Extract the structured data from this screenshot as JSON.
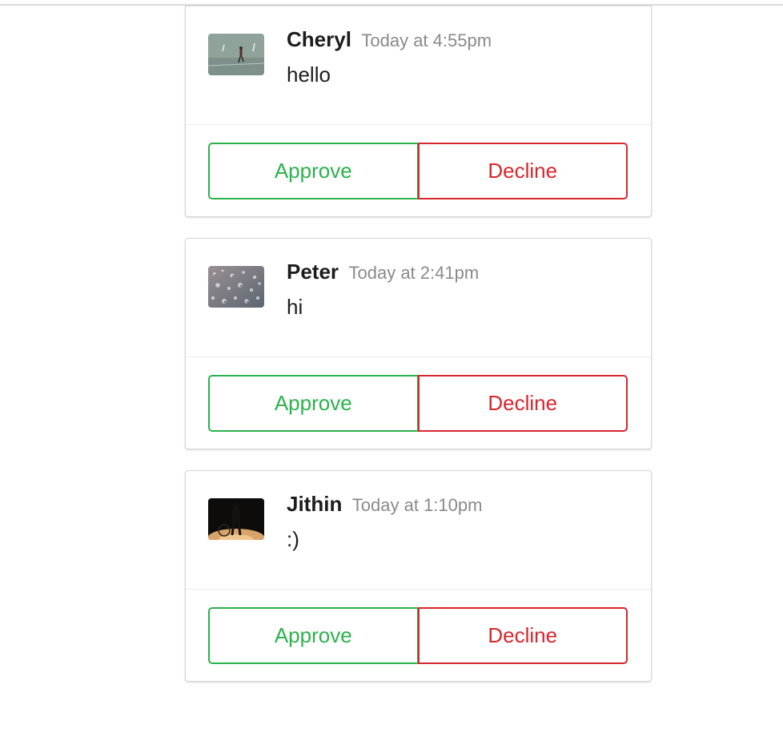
{
  "messages": [
    {
      "author": "Cheryl",
      "timestamp": "Today at 4:55pm",
      "text": "hello",
      "avatar_icon": "photo-person-walking",
      "approve_label": "Approve",
      "decline_label": "Decline"
    },
    {
      "author": "Peter",
      "timestamp": "Today at 2:41pm",
      "text": "hi",
      "avatar_icon": "photo-water-droplets",
      "approve_label": "Approve",
      "decline_label": "Decline"
    },
    {
      "author": "Jithin",
      "timestamp": "Today at 1:10pm",
      "text": ":)",
      "avatar_icon": "photo-dark-silhouette",
      "approve_label": "Approve",
      "decline_label": "Decline"
    }
  ],
  "colors": {
    "approve": "#2bb24c",
    "decline": "#d7262d",
    "timestamp": "#8a8a8a"
  }
}
